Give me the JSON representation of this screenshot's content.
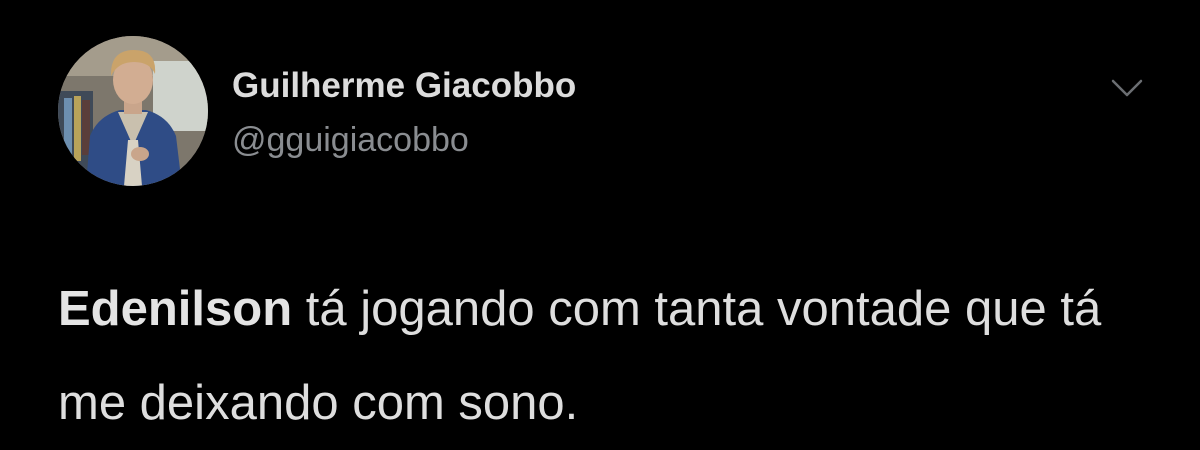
{
  "tweet": {
    "author": {
      "name": "Guilherme Giacobbo",
      "handle": "@gguigiacobbo"
    },
    "text": {
      "bold_name": "Edenilson",
      "rest": " tá jogando com tanta vontade que tá me deixando com sono."
    }
  },
  "icons": {
    "avatar": "profile-photo",
    "menu": "chevron-down-icon"
  },
  "colors": {
    "background": "#000000",
    "name_text": "#dcdcdc",
    "handle_text": "#8a8d91",
    "body_text": "#dedede"
  }
}
